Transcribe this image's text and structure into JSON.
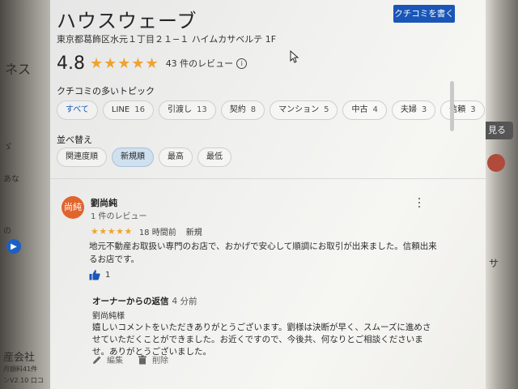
{
  "background": {
    "left_fragments": [
      "ネス",
      "ゞ",
      "あな",
      "の"
    ],
    "left_bottom": [
      "産会社",
      "月額料41件",
      "ンV2.10 口コ"
    ],
    "right_fragments": [
      "見る",
      "サ"
    ],
    "right_pill": "見る"
  },
  "place": {
    "title": "ハウスウェーブ",
    "address": "東京都葛飾区水元１丁目２１−１ ハイムカサベルテ 1F",
    "write_review_label": "クチコミを書く",
    "rating": "4.8",
    "stars": "★★★★★",
    "review_count": "43 件のレビュー",
    "info_symbol": "i"
  },
  "topics": {
    "label": "クチコミの多いトピック",
    "items": [
      {
        "label": "すべて",
        "count": ""
      },
      {
        "label": "LINE",
        "count": "16"
      },
      {
        "label": "引渡し",
        "count": "13"
      },
      {
        "label": "契約",
        "count": "8"
      },
      {
        "label": "マンション",
        "count": "5"
      },
      {
        "label": "中古",
        "count": "4"
      },
      {
        "label": "夫婦",
        "count": "3"
      },
      {
        "label": "信頼",
        "count": "3"
      }
    ]
  },
  "sort": {
    "label": "並べ替え",
    "options": [
      "関連度順",
      "新規順",
      "最高",
      "最低"
    ],
    "selected": "新規順"
  },
  "review": {
    "avatar_text": "尚純",
    "name": "劉尚純",
    "sub": "1 件のレビュー",
    "stars": "★★★★★",
    "time": "18 時間前",
    "badge": "新規",
    "text": "地元不動産お取扱い専門のお店で、おかげで安心して順調にお取引が出来ました。信頼出来るお店です。",
    "like_count": "1",
    "owner_title": "オーナーからの返信",
    "owner_time": "4 分前",
    "owner_to": "劉尚純様",
    "owner_text": "嬉しいコメントをいただきありがとうございます。劉様は決断が早く、スムーズに進めさせていただくことができました。お近くですので、今後共、何なりとご相談くださいませ。ありがとうございました。",
    "edit_label": "編集",
    "delete_label": "削除"
  },
  "colors": {
    "accent": "#1a56b8",
    "star": "#f0a32f",
    "avatar": "#e1642c",
    "selected_chip": "#cfe0ef"
  }
}
